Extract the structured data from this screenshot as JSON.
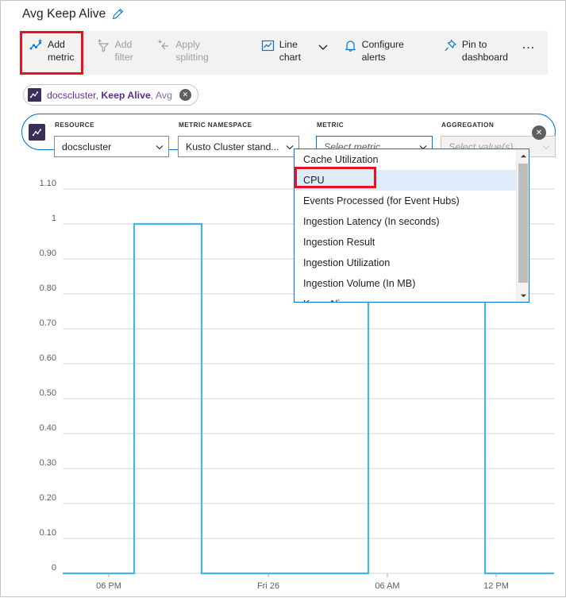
{
  "header": {
    "title": "Avg Keep Alive",
    "edit_icon": "pencil-icon"
  },
  "toolbar": {
    "buttons": [
      {
        "label": "Add metric",
        "icon": "add-metric-icon",
        "disabled": false,
        "highlighted": true
      },
      {
        "label": "Add filter",
        "icon": "add-filter-icon",
        "disabled": true,
        "highlighted": false
      },
      {
        "label": "Apply splitting",
        "icon": "apply-splitting-icon",
        "disabled": true,
        "highlighted": false
      },
      {
        "label": "Line chart",
        "icon": "line-chart-icon",
        "disabled": false,
        "highlighted": false
      },
      {
        "label": "Configure alerts",
        "icon": "bell-icon",
        "disabled": false,
        "highlighted": false
      },
      {
        "label": "Pin to dashboard",
        "icon": "pin-icon",
        "disabled": false,
        "highlighted": false
      }
    ],
    "chevron_icon": "chevron-down-icon",
    "more_label": "…"
  },
  "chip": {
    "glyph": "metric-chip-icon",
    "resource": "docscluster, ",
    "metric": "Keep Alive",
    "aggregation": ", Avg",
    "close_label": "✕"
  },
  "picker": {
    "glyph": "metric-chip-icon",
    "fields": [
      {
        "label": "RESOURCE",
        "value": "docscluster",
        "placeholder": "",
        "state": "filled"
      },
      {
        "label": "METRIC NAMESPACE",
        "value": "Kusto Cluster stand...",
        "placeholder": "",
        "state": "filled"
      },
      {
        "label": "METRIC",
        "value": "Select metric",
        "placeholder": "Select metric",
        "state": "placeholder"
      },
      {
        "label": "AGGREGATION",
        "value": "Select value(s)",
        "placeholder": "Select value(s)",
        "state": "disabled"
      }
    ],
    "close_label": "✕"
  },
  "dropdown": {
    "items": [
      {
        "label": "Cache Utilization",
        "selected": false
      },
      {
        "label": "CPU",
        "selected": true
      },
      {
        "label": "Events Processed (for Event Hubs)",
        "selected": false
      },
      {
        "label": "Ingestion Latency (In seconds)",
        "selected": false
      },
      {
        "label": "Ingestion Result",
        "selected": false
      },
      {
        "label": "Ingestion Utilization",
        "selected": false
      },
      {
        "label": "Ingestion Volume (In MB)",
        "selected": false
      },
      {
        "label": "Keep Alive",
        "selected": false
      }
    ],
    "scroll_up_icon": "chevron-up-icon",
    "scroll_down_icon": "chevron-down-icon"
  },
  "highlights": {
    "color": "#e81123",
    "boxes": [
      "add-metric-button",
      "dropdown-item-cpu"
    ]
  },
  "chart_data": {
    "type": "line",
    "title": "Avg Keep Alive",
    "xlabel": "",
    "ylabel": "",
    "series": [
      {
        "name": "docscluster, Keep Alive, Avg",
        "color": "#41b6e6",
        "x": [
          "16:00",
          "17:48",
          "17:49",
          "19:40",
          "19:41",
          "07:20",
          "07:21",
          "13:00",
          "13:01",
          "15:40"
        ],
        "values": [
          0,
          0,
          1,
          1,
          0,
          0,
          1,
          1,
          0,
          0
        ]
      }
    ],
    "ytick_labels": [
      "1.10",
      "1",
      "0.90",
      "0.80",
      "0.70",
      "0.60",
      "0.50",
      "0.40",
      "0.30",
      "0.20",
      "0.10",
      "0"
    ],
    "ytick_values": [
      1.1,
      1.0,
      0.9,
      0.8,
      0.7,
      0.6,
      0.5,
      0.4,
      0.3,
      0.2,
      0.1,
      0
    ],
    "ylim": [
      0,
      1.1
    ],
    "xtick_labels": [
      "06 PM",
      "Fri 26",
      "06 AM",
      "12 PM"
    ],
    "grid": true,
    "legend": "none"
  }
}
